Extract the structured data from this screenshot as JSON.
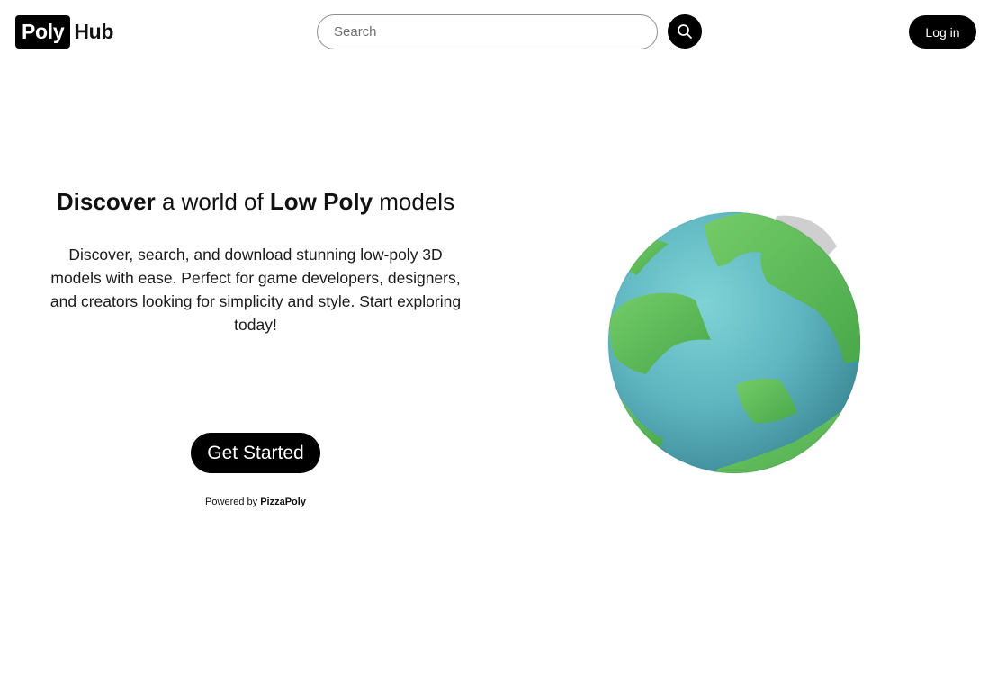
{
  "header": {
    "logo_box": "Poly",
    "logo_text": "Hub",
    "search_placeholder": "Search",
    "search_icon": "search-icon",
    "login_label": "Log in"
  },
  "hero": {
    "title_bold_1": "Discover",
    "title_mid": " a world of ",
    "title_bold_2": "Low Poly",
    "title_end": " models",
    "description": "Discover, search, and download stunning low-poly 3D models with ease. Perfect for game developers, designers, and creators looking for simplicity and style. Start exploring today!",
    "cta_label": "Get Started",
    "powered_prefix": "Powered by ",
    "powered_brand": "PizzaPoly"
  },
  "colors": {
    "primary": "#000000",
    "background": "#ffffff",
    "globe_ocean": "#6fc6cc",
    "globe_land": "#5cb85a"
  }
}
